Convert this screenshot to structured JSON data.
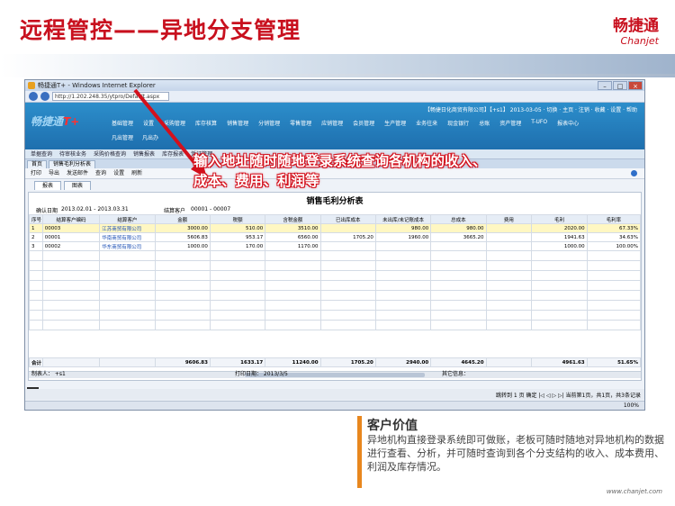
{
  "slide": {
    "title": "远程管控——异地分支管理",
    "logo_cn": "畅捷通",
    "logo_en": "Chanjet",
    "website": "www.chanjet.com"
  },
  "browser": {
    "title": "畅捷通T+ - Windows Internet Explorer",
    "url": "http://1.202.248.35/ytpro/Default.aspx",
    "status_zoom": "100%"
  },
  "app": {
    "logo": "畅捷通",
    "logo_mark": "T+",
    "header_info": "【畅捷日化商贸有限公司】【+s1】 2013-03-05 · 切换 · 主页 · 注销 · 收藏 · 设置 · 帮助",
    "menu": [
      "基础管理",
      "设置",
      "采购管理",
      "库存核算",
      "销售管理",
      "分销管理",
      "零售管理",
      "应销管理",
      "会员管理",
      "生产管理",
      "业务往来",
      "现金银行",
      "总账",
      "资产管理",
      "T-UFO",
      "报表中心"
    ],
    "menu2": [
      "凡出管理",
      "凡出办"
    ],
    "shortcuts": [
      "单据查询",
      "待审核业务",
      "采购价格查询",
      "销售报表",
      "库存报表",
      "凭证管理"
    ],
    "tabs": [
      "首页",
      "销售毛利分析表"
    ],
    "toolbar": [
      "打印",
      "导出",
      "发送邮件",
      "查询",
      "设置",
      "刷新"
    ],
    "report_tabs": [
      "报表",
      "图表"
    ]
  },
  "report": {
    "title": "销售毛利分析表",
    "period_label": "确认日期",
    "period": "2013.02.01 - 2013.03.31",
    "customer_label": "结算客户",
    "customer_range": "00001 - 00007",
    "columns": [
      "序号",
      "结算客户编码",
      "结算客户",
      "金额",
      "税额",
      "含税金额",
      "已出库成本",
      "未出库/未记账成本",
      "总成本",
      "费用",
      "毛利",
      "毛利率"
    ],
    "rows": [
      [
        "1",
        "00003",
        "江苏商贸有限公司",
        "3000.00",
        "510.00",
        "3510.00",
        "",
        "980.00",
        "980.00",
        "",
        "2020.00",
        "67.33%"
      ],
      [
        "2",
        "00001",
        "华南商贸有限公司",
        "5606.83",
        "953.17",
        "6560.00",
        "1705.20",
        "1960.00",
        "3665.20",
        "",
        "1941.63",
        "34.63%"
      ],
      [
        "3",
        "00002",
        "华东商贸有限公司",
        "1000.00",
        "170.00",
        "1170.00",
        "",
        "",
        "",
        "",
        "1000.00",
        "100.00%"
      ]
    ],
    "total": [
      "合计",
      "",
      "",
      "9606.83",
      "1633.17",
      "11240.00",
      "1705.20",
      "2940.00",
      "4645.20",
      "",
      "4961.63",
      "51.65%"
    ],
    "maker": "制表人： +s1",
    "print_date": "打印日期： 2013/3/5",
    "other_info": "其它信息：",
    "pager": "跳转到 1 页 确定 |◁ ◁ ▷ ▷| 当前第1页，共1页，共3条记录"
  },
  "annotation": "输入地址随时随地登录系统查询各机构的收入、成本、费用、利润等",
  "value": {
    "heading": "客户价值",
    "body": "异地机构直接登录系统即可做账，老板可随时随地对异地机构的数据进行查看、分析，并可随时查询到各个分支结构的收入、成本费用、利润及库存情况。"
  },
  "colors": {
    "brand_red": "#c8101e",
    "annotation_red": "#d3101c",
    "accent_orange": "#e8871e",
    "app_blue": "#1e6fae"
  }
}
